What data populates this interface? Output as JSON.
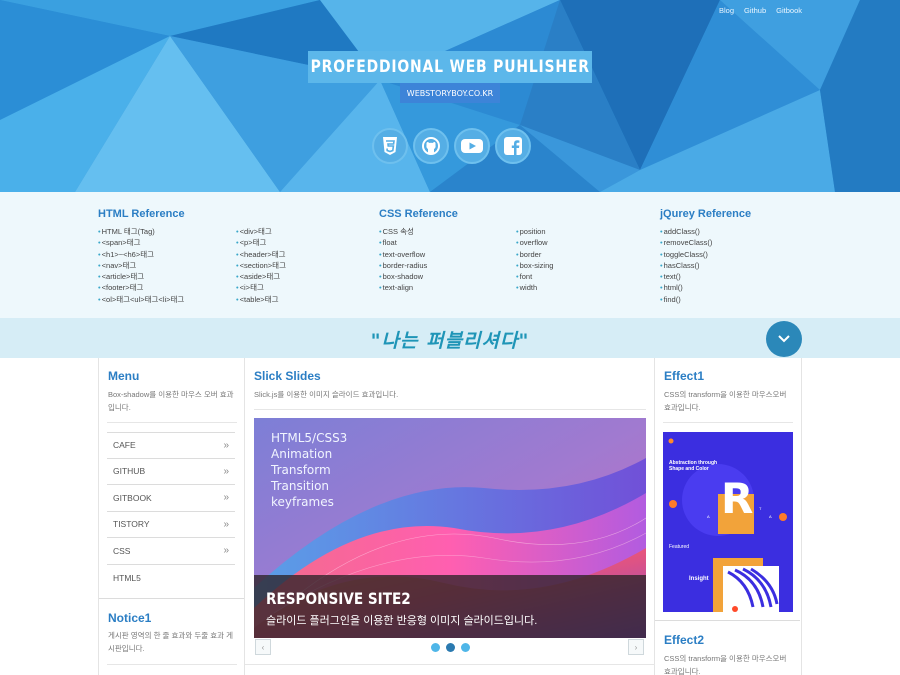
{
  "header": {
    "nav": [
      "Blog",
      "Github",
      "Gitbook"
    ],
    "title": "PROFEDDIONAL WEB PUHLISHER",
    "subtitle": "WEBSTORYBOY.CO.KR",
    "social_icons": [
      "css3-icon",
      "github-icon",
      "youtube-icon",
      "facebook-icon"
    ]
  },
  "refs": {
    "html": {
      "title": "HTML Reference",
      "col1": [
        "HTML 태그(Tag)",
        "<span>태그",
        "<h1>~<h6>태그",
        "<nav>태그",
        "<article>태그",
        "<footer>태그",
        "<ol>태그<ul>태그<li>태그"
      ],
      "col2": [
        "<div>태그",
        "<p>태그",
        "<header>태그",
        "<section>태그",
        "<aside>태그",
        "<i>태그",
        "<table>태그"
      ]
    },
    "css": {
      "title": "CSS Reference",
      "col1": [
        "CSS 속성",
        "float",
        "text-overflow",
        "border-radius",
        "box-shadow",
        "text-align"
      ],
      "col2": [
        "position",
        "overflow",
        "border",
        "box-sizing",
        "font",
        "width"
      ]
    },
    "jquery": {
      "title": "jQurey Reference",
      "col1": [
        "addClass()",
        "removeClass()",
        "toggleClass()",
        "hasClass()",
        "text()",
        "html()",
        "find()"
      ]
    }
  },
  "band": {
    "slogan": "\"나는 퍼블리셔다\""
  },
  "menu": {
    "title": "Menu",
    "desc": "Box-shadow를 이용한 마우스 오버 효과입니다.",
    "items": [
      "CAFE",
      "GITHUB",
      "GITBOOK",
      "TISTORY",
      "CSS",
      "HTML5"
    ],
    "arrow": "»"
  },
  "notice": {
    "title": "Notice1",
    "desc": "게시판 영역의 한 줄 효과와 두줄 효과 게시판입니다."
  },
  "slick": {
    "title": "Slick Slides",
    "desc": "Slick.js를 이용한 이미지 슬라이드 효과입니다.",
    "slide_lines": [
      "HTML5/CSS3",
      "Animation",
      "Transform",
      "Transition",
      "keyframes"
    ],
    "caption_title": "RESPONSIVE SITE2",
    "caption_desc": "슬라이드 플러그인을 이용한 반응형 이미지 슬라이드입니다.",
    "prev": "‹",
    "next": "›",
    "dots": 3,
    "active_dot": 2
  },
  "effect1": {
    "title": "Effect1",
    "desc": "CSS의 transform을 이용한 마우스오버 효과입니다.",
    "poster_heading": "Abstraction through Shape and Color",
    "poster_letters": [
      "R",
      "A",
      "T",
      "A"
    ],
    "poster_featured": "Featured",
    "poster_insight": "Insight"
  },
  "effect2": {
    "title": "Effect2",
    "desc": "CSS의 transform을 이용한 마우스오버 효과입니다."
  },
  "colors": {
    "accent": "#2b7ec4",
    "header_bg": "#2f8fd3",
    "band_bg": "#d6edf6",
    "refs_bg": "#eef8fc"
  }
}
